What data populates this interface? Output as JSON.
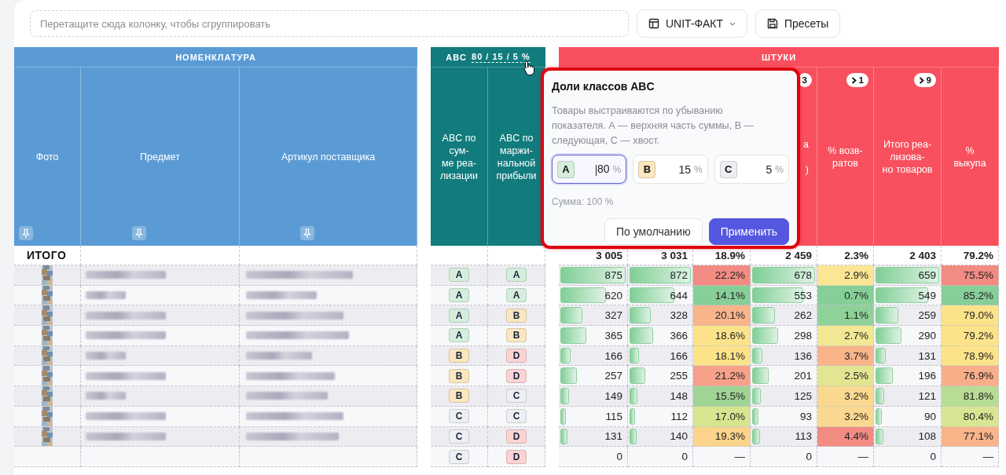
{
  "toolbar": {
    "group_drop_zone": {
      "placeholder": "Перетащите сюда колонку, чтобы сгруппировать"
    },
    "buttons": [
      {
        "label": "UNIT-ФАКТ",
        "kind": "dropdown"
      },
      {
        "label": "Пресеты",
        "kind": "save"
      }
    ]
  },
  "table": {
    "groups": [
      {
        "title": "НОМЕНКЛАТУРА",
        "color": "#5b9bd5",
        "columns": [
          {
            "label": "Фото",
            "pinned": true
          },
          {
            "label": "Предмет",
            "pinned": true
          },
          {
            "label": "Артикул поставщика",
            "pinned": true
          }
        ]
      },
      {
        "title": "ABC",
        "note": "80 / 15 / 5 %",
        "color": "#127b7d",
        "columns": [
          {
            "label": "ABC по\nсум-\nме реа-\nлизации"
          },
          {
            "label": "ABC по\nмаржи-\nнальной\nприбыли"
          }
        ]
      },
      {
        "title": "ШТУКИ",
        "color": "#f8505e",
        "columns": [
          {},
          {},
          {},
          {
            "badge": {
              "text": "3",
              "chevron": false
            },
            "label": "а\n\n)"
          },
          {
            "badge": {
              "text": "1",
              "chevron": true
            },
            "label": "% возв-\nратов"
          },
          {
            "badge": {
              "text": "9",
              "chevron": true
            },
            "label": "Итого реа-\nлизова-\nно товаров"
          },
          {
            "label": "%\nвыкупа"
          }
        ]
      }
    ],
    "totals": {
      "label": "ИТОГО",
      "values": [
        "3 005",
        "3 031",
        "18.9%",
        "2 459",
        "2.3%",
        "2 403",
        "79.2%"
      ]
    },
    "rows": [
      {
        "redacted": true,
        "abc": [
          {
            "label": "A",
            "color": "#d5eedc"
          },
          {
            "label": "A",
            "color": "#d5eedc"
          }
        ],
        "cells": [
          {
            "value": "875",
            "level": 1
          },
          {
            "value": "872",
            "level": 1
          },
          {
            "value": "22.2%",
            "color": "#f28b82"
          },
          {
            "value": "678",
            "level": 1
          },
          {
            "value": "2.9%",
            "color": "#fbe695"
          },
          {
            "value": "659",
            "level": 1
          },
          {
            "value": "75.5%",
            "color": "#f28b82"
          }
        ]
      },
      {
        "redacted": true,
        "abc": [
          {
            "label": "A",
            "color": "#d5eedc"
          },
          {
            "label": "A",
            "color": "#d5eedc"
          }
        ],
        "cells": [
          {
            "value": "620",
            "level": 0.71
          },
          {
            "value": "644",
            "level": 0.74
          },
          {
            "value": "14.1%",
            "color": "#86cf98"
          },
          {
            "value": "553",
            "level": 0.82
          },
          {
            "value": "0.7%",
            "color": "#86cf98"
          },
          {
            "value": "549",
            "level": 0.83
          },
          {
            "value": "85.2%",
            "color": "#86cf98"
          }
        ]
      },
      {
        "redacted": true,
        "abc": [
          {
            "label": "A",
            "color": "#d5eedc"
          },
          {
            "label": "B",
            "color": "#fbe7bf"
          }
        ],
        "cells": [
          {
            "value": "327",
            "level": 0.37
          },
          {
            "value": "328",
            "level": 0.38
          },
          {
            "value": "20.1%",
            "color": "#f9b48a"
          },
          {
            "value": "262",
            "level": 0.39
          },
          {
            "value": "1.1%",
            "color": "#8fd198"
          },
          {
            "value": "259",
            "level": 0.39
          },
          {
            "value": "79.0%",
            "color": "#fce38a"
          }
        ]
      },
      {
        "redacted": true,
        "abc": [
          {
            "label": "A",
            "color": "#d5eedc"
          },
          {
            "label": "B",
            "color": "#fbe7bf"
          }
        ],
        "cells": [
          {
            "value": "365",
            "level": 0.42
          },
          {
            "value": "366",
            "level": 0.42
          },
          {
            "value": "18.6%",
            "color": "#fce38a"
          },
          {
            "value": "298",
            "level": 0.44
          },
          {
            "value": "2.7%",
            "color": "#f1e794"
          },
          {
            "value": "290",
            "level": 0.44
          },
          {
            "value": "79.2%",
            "color": "#fce38a"
          }
        ]
      },
      {
        "redacted": true,
        "abc": [
          {
            "label": "B",
            "color": "#fbe7bf"
          },
          {
            "label": "D",
            "color": "#fbd3d3"
          }
        ],
        "cells": [
          {
            "value": "166",
            "level": 0.19
          },
          {
            "value": "166",
            "level": 0.19
          },
          {
            "value": "18.1%",
            "color": "#fce38a"
          },
          {
            "value": "136",
            "level": 0.2
          },
          {
            "value": "3.7%",
            "color": "#f9b48a"
          },
          {
            "value": "131",
            "level": 0.2
          },
          {
            "value": "78.9%",
            "color": "#fce38a"
          }
        ]
      },
      {
        "redacted": true,
        "abc": [
          {
            "label": "B",
            "color": "#fbe7bf"
          },
          {
            "label": "D",
            "color": "#fbd3d3"
          }
        ],
        "cells": [
          {
            "value": "257",
            "level": 0.29
          },
          {
            "value": "255",
            "level": 0.29
          },
          {
            "value": "21.2%",
            "color": "#f7a08a"
          },
          {
            "value": "201",
            "level": 0.3
          },
          {
            "value": "2.5%",
            "color": "#e4e592"
          },
          {
            "value": "196",
            "level": 0.3
          },
          {
            "value": "76.9%",
            "color": "#f9ae8a"
          }
        ]
      },
      {
        "redacted": true,
        "abc": [
          {
            "label": "B",
            "color": "#fbe7bf"
          },
          {
            "label": "C",
            "color": "#eeeff3"
          }
        ],
        "cells": [
          {
            "value": "149",
            "level": 0.17
          },
          {
            "value": "148",
            "level": 0.17
          },
          {
            "value": "15.5%",
            "color": "#9fd494"
          },
          {
            "value": "125",
            "level": 0.18
          },
          {
            "value": "3.2%",
            "color": "#fbd890"
          },
          {
            "value": "121",
            "level": 0.18
          },
          {
            "value": "81.8%",
            "color": "#b7dc94"
          }
        ]
      },
      {
        "redacted": true,
        "abc": [
          {
            "label": "C",
            "color": "#eeeff3"
          },
          {
            "label": "C",
            "color": "#eeeff3"
          }
        ],
        "cells": [
          {
            "value": "115",
            "level": 0.13
          },
          {
            "value": "112",
            "level": 0.13
          },
          {
            "value": "17.0%",
            "color": "#d6e58f"
          },
          {
            "value": "93",
            "level": 0.14
          },
          {
            "value": "3.2%",
            "color": "#fbd890"
          },
          {
            "value": "90",
            "level": 0.14
          },
          {
            "value": "80.4%",
            "color": "#d9e592"
          }
        ]
      },
      {
        "redacted": true,
        "abc": [
          {
            "label": "C",
            "color": "#eeeff3"
          },
          {
            "label": "D",
            "color": "#fbd3d3"
          }
        ],
        "cells": [
          {
            "value": "131",
            "level": 0.15
          },
          {
            "value": "140",
            "level": 0.16
          },
          {
            "value": "19.3%",
            "color": "#fbd38a"
          },
          {
            "value": "113",
            "level": 0.17
          },
          {
            "value": "4.4%",
            "color": "#f28b82"
          },
          {
            "value": "108",
            "level": 0.16
          },
          {
            "value": "77.1%",
            "color": "#f9b48a"
          }
        ]
      },
      {
        "redacted": false,
        "abc": [
          {
            "label": "C",
            "color": "#eeeff3"
          },
          {
            "label": "D",
            "color": "#fbd3d3"
          }
        ],
        "cells": [
          {
            "value": "0"
          },
          {
            "value": "0"
          },
          {
            "value": "—"
          },
          {
            "value": "0"
          },
          {
            "value": "—"
          },
          {
            "value": "0"
          },
          {
            "value": "—"
          }
        ]
      }
    ]
  },
  "abc_popup": {
    "highlighted": true,
    "title": "Доли классов ABC",
    "description": "Товары выстраиваются по убыванию показателя. А — верхняя часть суммы, В — следующая, С — хвост.",
    "fields": [
      {
        "class": "A",
        "color": "#d5eedc",
        "value": "80",
        "unit": "%",
        "focused": true
      },
      {
        "class": "B",
        "color": "#fbe7bf",
        "value": "15",
        "unit": "%",
        "focused": false
      },
      {
        "class": "C",
        "color": "#eeeff3",
        "value": "5",
        "unit": "%",
        "focused": false
      }
    ],
    "sum": "Сумма: 100 %",
    "buttons": [
      {
        "label": "По умолчанию",
        "primary": false
      },
      {
        "label": "Применить",
        "primary": true
      }
    ]
  }
}
